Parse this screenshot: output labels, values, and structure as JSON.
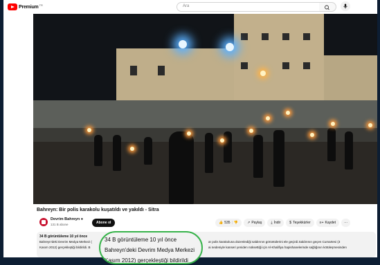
{
  "header": {
    "logo_text": "Premium",
    "logo_tm": "TR",
    "search_placeholder": "Ara"
  },
  "video": {
    "title": "Bahreyn: Bir polis karakolu kuşatıldı ve yakıldı - Sitra"
  },
  "channel": {
    "name": "Devrim Bahreyn",
    "subscribers": "131 B abone",
    "subscribe_label": "Abone ol"
  },
  "actions": {
    "like_count": "535",
    "share_label": "Paylaş",
    "download_label": "İndir",
    "thanks_label": "Teşekkürler",
    "save_label": "Kaydet"
  },
  "description": {
    "stats": "34 B görüntüleme  10 yıl önce",
    "line1_a": "Bahreyn'deki Devrim Medya Merkezi (",
    "line1_b": "ar polis karakoluna düzenlediği saldırının görüntülerini ele geçirdi.Saldırının geçen Cumartesi (3",
    "line2_a": "Kasım 2012) gerçekleştiği bildirildi. B",
    "line2_b": "ai nedeniyle kanseri yeniden nüksettiği için Al-Khalifiya hapishanelerinde sağlığının kötüleşmesinden"
  },
  "zoom": {
    "line1": "34 B görüntüleme  10 yıl önce",
    "line2": "Bahreyn'deki Devrim Medya Merkezi",
    "line3": "Kasım 2012) gerçekleştiği bildirildi"
  },
  "colors": {
    "accent_red": "#ff0000",
    "highlight_green": "#37b34a",
    "frame_bg": "#0d1e33"
  }
}
